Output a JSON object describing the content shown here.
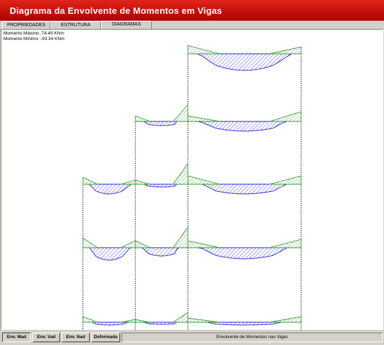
{
  "window": {
    "title": "Diagrama da Envolvente de Momentos em Vigas"
  },
  "tabs": [
    {
      "label": "PROPRIEDADES",
      "active": false
    },
    {
      "label": "ESTRUTURA",
      "active": false
    },
    {
      "label": "DIAGRAMAS",
      "active": true
    }
  ],
  "info": {
    "max_moment": "Momento Máximo :74.49 KNm",
    "min_moment": "Momento Mínimo :-93.34 KNm"
  },
  "colors": {
    "positive": "#2f9a2f",
    "negative": "#2020d0",
    "title_bar": "#c0100a"
  },
  "buttons": [
    {
      "label": "Env. Mad",
      "pressed": true
    },
    {
      "label": "Env. Vad",
      "pressed": false
    },
    {
      "label": "Env. Nad",
      "pressed": false
    },
    {
      "label": "Deformada",
      "pressed": false
    }
  ],
  "status_text": "Envolvente de Momentos nas Vigas"
}
